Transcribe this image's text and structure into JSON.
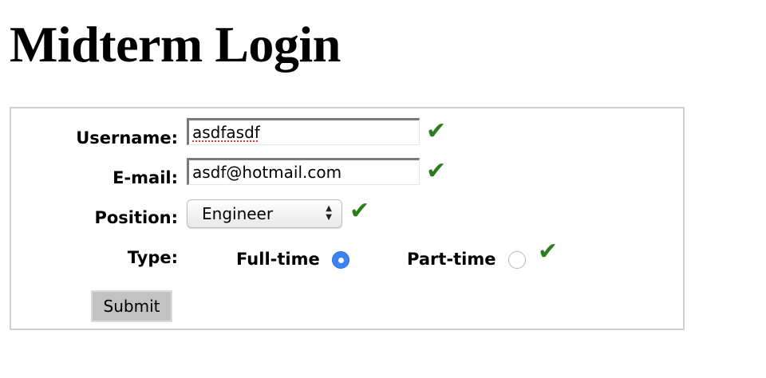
{
  "page": {
    "title": "Midterm Login"
  },
  "form": {
    "username": {
      "label": "Username:",
      "value": "asdfasdf",
      "valid": true
    },
    "email": {
      "label": "E-mail:",
      "value": "asdf@hotmail.com",
      "valid": true
    },
    "position": {
      "label": "Position:",
      "selected": "Engineer",
      "valid": true
    },
    "type": {
      "label": "Type:",
      "options": [
        {
          "label": "Full-time",
          "checked": true
        },
        {
          "label": "Part-time",
          "checked": false
        }
      ],
      "valid": true
    },
    "submit_label": "Submit",
    "check_glyph": "✔",
    "colors": {
      "check": "#2e7d1c",
      "radio_selected": "#3b82f6"
    }
  }
}
